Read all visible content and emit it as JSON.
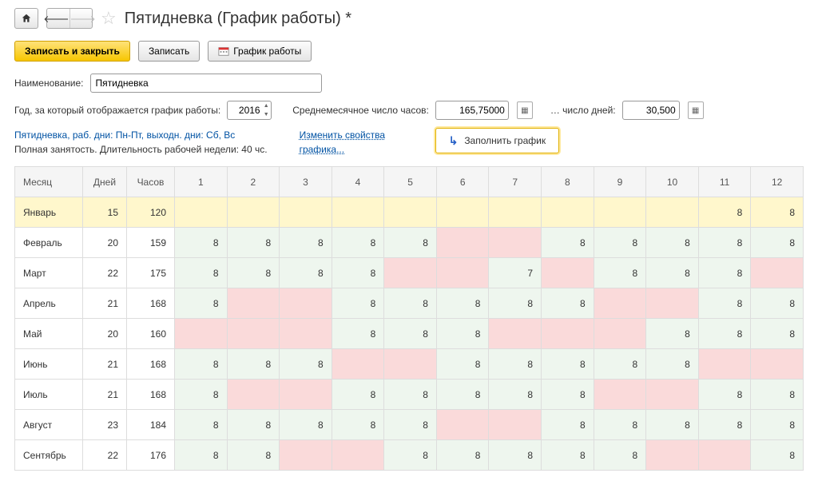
{
  "title": "Пятидневка (График работы) *",
  "toolbar": {
    "save_close": "Записать и закрыть",
    "save": "Записать",
    "schedule": "График работы"
  },
  "form": {
    "name_label": "Наименование:",
    "name_value": "Пятидневка",
    "year_label": "Год, за который отображается график работы:",
    "year_value": "2016",
    "avg_hours_label": "Среднемесячное число часов:",
    "avg_hours_value": "165,75000",
    "days_label": "… число дней:",
    "days_value": "30,500"
  },
  "info": {
    "line1": "Пятидневка, раб. дни: Пн-Пт, выходн. дни: Сб, Вс",
    "line2": "Полная занятость. Длительность рабочей недели: 40 чс.",
    "link": "Изменить свойства графика...",
    "fill_btn": "Заполнить график"
  },
  "headers": {
    "month": "Месяц",
    "days": "Дней",
    "hours": "Часов"
  },
  "day_cols": [
    "1",
    "2",
    "3",
    "4",
    "5",
    "6",
    "7",
    "8",
    "9",
    "10",
    "11",
    "12"
  ],
  "rows": [
    {
      "month": "Январь",
      "days": "15",
      "hours": "120",
      "selected": true,
      "cells": [
        {
          "v": "",
          "c": ""
        },
        {
          "v": "",
          "c": ""
        },
        {
          "v": "",
          "c": ""
        },
        {
          "v": "",
          "c": ""
        },
        {
          "v": "",
          "c": ""
        },
        {
          "v": "",
          "c": ""
        },
        {
          "v": "",
          "c": ""
        },
        {
          "v": "",
          "c": ""
        },
        {
          "v": "",
          "c": ""
        },
        {
          "v": "",
          "c": ""
        },
        {
          "v": "8",
          "c": ""
        },
        {
          "v": "8",
          "c": ""
        }
      ]
    },
    {
      "month": "Февраль",
      "days": "20",
      "hours": "159",
      "cells": [
        {
          "v": "8",
          "c": "workday"
        },
        {
          "v": "8",
          "c": "workday"
        },
        {
          "v": "8",
          "c": "workday"
        },
        {
          "v": "8",
          "c": "workday"
        },
        {
          "v": "8",
          "c": "workday"
        },
        {
          "v": "",
          "c": "weekend"
        },
        {
          "v": "",
          "c": "weekend"
        },
        {
          "v": "8",
          "c": "workday"
        },
        {
          "v": "8",
          "c": "workday"
        },
        {
          "v": "8",
          "c": "workday"
        },
        {
          "v": "8",
          "c": "workday"
        },
        {
          "v": "8",
          "c": "workday"
        }
      ]
    },
    {
      "month": "Март",
      "days": "22",
      "hours": "175",
      "cells": [
        {
          "v": "8",
          "c": "workday"
        },
        {
          "v": "8",
          "c": "workday"
        },
        {
          "v": "8",
          "c": "workday"
        },
        {
          "v": "8",
          "c": "workday"
        },
        {
          "v": "",
          "c": "weekend"
        },
        {
          "v": "",
          "c": "weekend"
        },
        {
          "v": "7",
          "c": "workday"
        },
        {
          "v": "",
          "c": "weekend"
        },
        {
          "v": "8",
          "c": "workday"
        },
        {
          "v": "8",
          "c": "workday"
        },
        {
          "v": "8",
          "c": "workday"
        },
        {
          "v": "",
          "c": "weekend"
        }
      ]
    },
    {
      "month": "Апрель",
      "days": "21",
      "hours": "168",
      "cells": [
        {
          "v": "8",
          "c": "workday"
        },
        {
          "v": "",
          "c": "weekend"
        },
        {
          "v": "",
          "c": "weekend"
        },
        {
          "v": "8",
          "c": "workday"
        },
        {
          "v": "8",
          "c": "workday"
        },
        {
          "v": "8",
          "c": "workday"
        },
        {
          "v": "8",
          "c": "workday"
        },
        {
          "v": "8",
          "c": "workday"
        },
        {
          "v": "",
          "c": "weekend"
        },
        {
          "v": "",
          "c": "weekend"
        },
        {
          "v": "8",
          "c": "workday"
        },
        {
          "v": "8",
          "c": "workday"
        }
      ]
    },
    {
      "month": "Май",
      "days": "20",
      "hours": "160",
      "cells": [
        {
          "v": "",
          "c": "weekend"
        },
        {
          "v": "",
          "c": "weekend"
        },
        {
          "v": "",
          "c": "weekend"
        },
        {
          "v": "8",
          "c": "workday"
        },
        {
          "v": "8",
          "c": "workday"
        },
        {
          "v": "8",
          "c": "workday"
        },
        {
          "v": "",
          "c": "weekend"
        },
        {
          "v": "",
          "c": "weekend"
        },
        {
          "v": "",
          "c": "weekend"
        },
        {
          "v": "8",
          "c": "workday"
        },
        {
          "v": "8",
          "c": "workday"
        },
        {
          "v": "8",
          "c": "workday"
        }
      ]
    },
    {
      "month": "Июнь",
      "days": "21",
      "hours": "168",
      "cells": [
        {
          "v": "8",
          "c": "workday"
        },
        {
          "v": "8",
          "c": "workday"
        },
        {
          "v": "8",
          "c": "workday"
        },
        {
          "v": "",
          "c": "weekend"
        },
        {
          "v": "",
          "c": "weekend"
        },
        {
          "v": "8",
          "c": "workday"
        },
        {
          "v": "8",
          "c": "workday"
        },
        {
          "v": "8",
          "c": "workday"
        },
        {
          "v": "8",
          "c": "workday"
        },
        {
          "v": "8",
          "c": "workday"
        },
        {
          "v": "",
          "c": "weekend"
        },
        {
          "v": "",
          "c": "weekend"
        }
      ]
    },
    {
      "month": "Июль",
      "days": "21",
      "hours": "168",
      "cells": [
        {
          "v": "8",
          "c": "workday"
        },
        {
          "v": "",
          "c": "weekend"
        },
        {
          "v": "",
          "c": "weekend"
        },
        {
          "v": "8",
          "c": "workday"
        },
        {
          "v": "8",
          "c": "workday"
        },
        {
          "v": "8",
          "c": "workday"
        },
        {
          "v": "8",
          "c": "workday"
        },
        {
          "v": "8",
          "c": "workday"
        },
        {
          "v": "",
          "c": "weekend"
        },
        {
          "v": "",
          "c": "weekend"
        },
        {
          "v": "8",
          "c": "workday"
        },
        {
          "v": "8",
          "c": "workday"
        }
      ]
    },
    {
      "month": "Август",
      "days": "23",
      "hours": "184",
      "cells": [
        {
          "v": "8",
          "c": "workday"
        },
        {
          "v": "8",
          "c": "workday"
        },
        {
          "v": "8",
          "c": "workday"
        },
        {
          "v": "8",
          "c": "workday"
        },
        {
          "v": "8",
          "c": "workday"
        },
        {
          "v": "",
          "c": "weekend"
        },
        {
          "v": "",
          "c": "weekend"
        },
        {
          "v": "8",
          "c": "workday"
        },
        {
          "v": "8",
          "c": "workday"
        },
        {
          "v": "8",
          "c": "workday"
        },
        {
          "v": "8",
          "c": "workday"
        },
        {
          "v": "8",
          "c": "workday"
        }
      ]
    },
    {
      "month": "Сентябрь",
      "days": "22",
      "hours": "176",
      "cells": [
        {
          "v": "8",
          "c": "workday"
        },
        {
          "v": "8",
          "c": "workday"
        },
        {
          "v": "",
          "c": "weekend"
        },
        {
          "v": "",
          "c": "weekend"
        },
        {
          "v": "8",
          "c": "workday"
        },
        {
          "v": "8",
          "c": "workday"
        },
        {
          "v": "8",
          "c": "workday"
        },
        {
          "v": "8",
          "c": "workday"
        },
        {
          "v": "8",
          "c": "workday"
        },
        {
          "v": "",
          "c": "weekend"
        },
        {
          "v": "",
          "c": "weekend"
        },
        {
          "v": "8",
          "c": "workday"
        }
      ]
    }
  ]
}
